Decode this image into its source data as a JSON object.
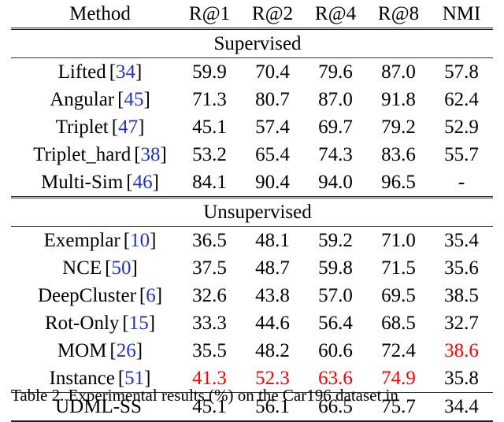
{
  "table": {
    "columns": [
      "Method",
      "R@1",
      "R@2",
      "R@4",
      "R@8",
      "NMI"
    ],
    "sections": [
      {
        "label": "Supervised",
        "rows": [
          {
            "method": "Lifted",
            "cite": "34",
            "values": [
              "59.9",
              "70.4",
              "79.6",
              "87.0",
              "57.8"
            ]
          },
          {
            "method": "Angular",
            "cite": "45",
            "values": [
              "71.3",
              "80.7",
              "87.0",
              "91.8",
              "62.4"
            ]
          },
          {
            "method": "Triplet",
            "cite": "47",
            "values": [
              "45.1",
              "57.4",
              "69.7",
              "79.2",
              "52.9"
            ]
          },
          {
            "method": "Triplet_hard",
            "cite": "38",
            "values": [
              "53.2",
              "65.4",
              "74.3",
              "83.6",
              "55.7"
            ]
          },
          {
            "method": "Multi-Sim",
            "cite": "46",
            "values": [
              "84.1",
              "90.4",
              "94.0",
              "96.5",
              "-"
            ]
          }
        ]
      },
      {
        "label": "Unsupervised",
        "rows": [
          {
            "method": "Exemplar",
            "cite": "10",
            "values": [
              "36.5",
              "48.1",
              "59.2",
              "71.0",
              "35.4"
            ]
          },
          {
            "method": "NCE",
            "cite": "50",
            "values": [
              "37.5",
              "48.7",
              "59.8",
              "71.5",
              "35.6"
            ]
          },
          {
            "method": "DeepCluster",
            "cite": "6",
            "values": [
              "32.6",
              "43.8",
              "57.0",
              "69.5",
              "38.5"
            ]
          },
          {
            "method": "Rot-Only",
            "cite": "15",
            "values": [
              "33.3",
              "44.6",
              "56.4",
              "68.5",
              "32.7"
            ]
          },
          {
            "method": "MOM",
            "cite": "26",
            "values": [
              "35.5",
              "48.2",
              "60.6",
              "72.4",
              "38.6"
            ]
          },
          {
            "method": "Instance",
            "cite": "51",
            "values": [
              "41.3",
              "52.3",
              "63.6",
              "74.9",
              "35.8"
            ]
          }
        ]
      }
    ],
    "final_row": {
      "method": "UDML-SS",
      "cite": "",
      "values": [
        "45.1",
        "56.1",
        "66.5",
        "75.7",
        "34.4"
      ]
    }
  },
  "caption": {
    "text": "Table 2. Experimental results (%) on the Car196 dataset in"
  },
  "colors": {
    "highlight_red": "#ff0000",
    "citation_blue": "#2233bb",
    "rule": "#1a1a1a"
  }
}
